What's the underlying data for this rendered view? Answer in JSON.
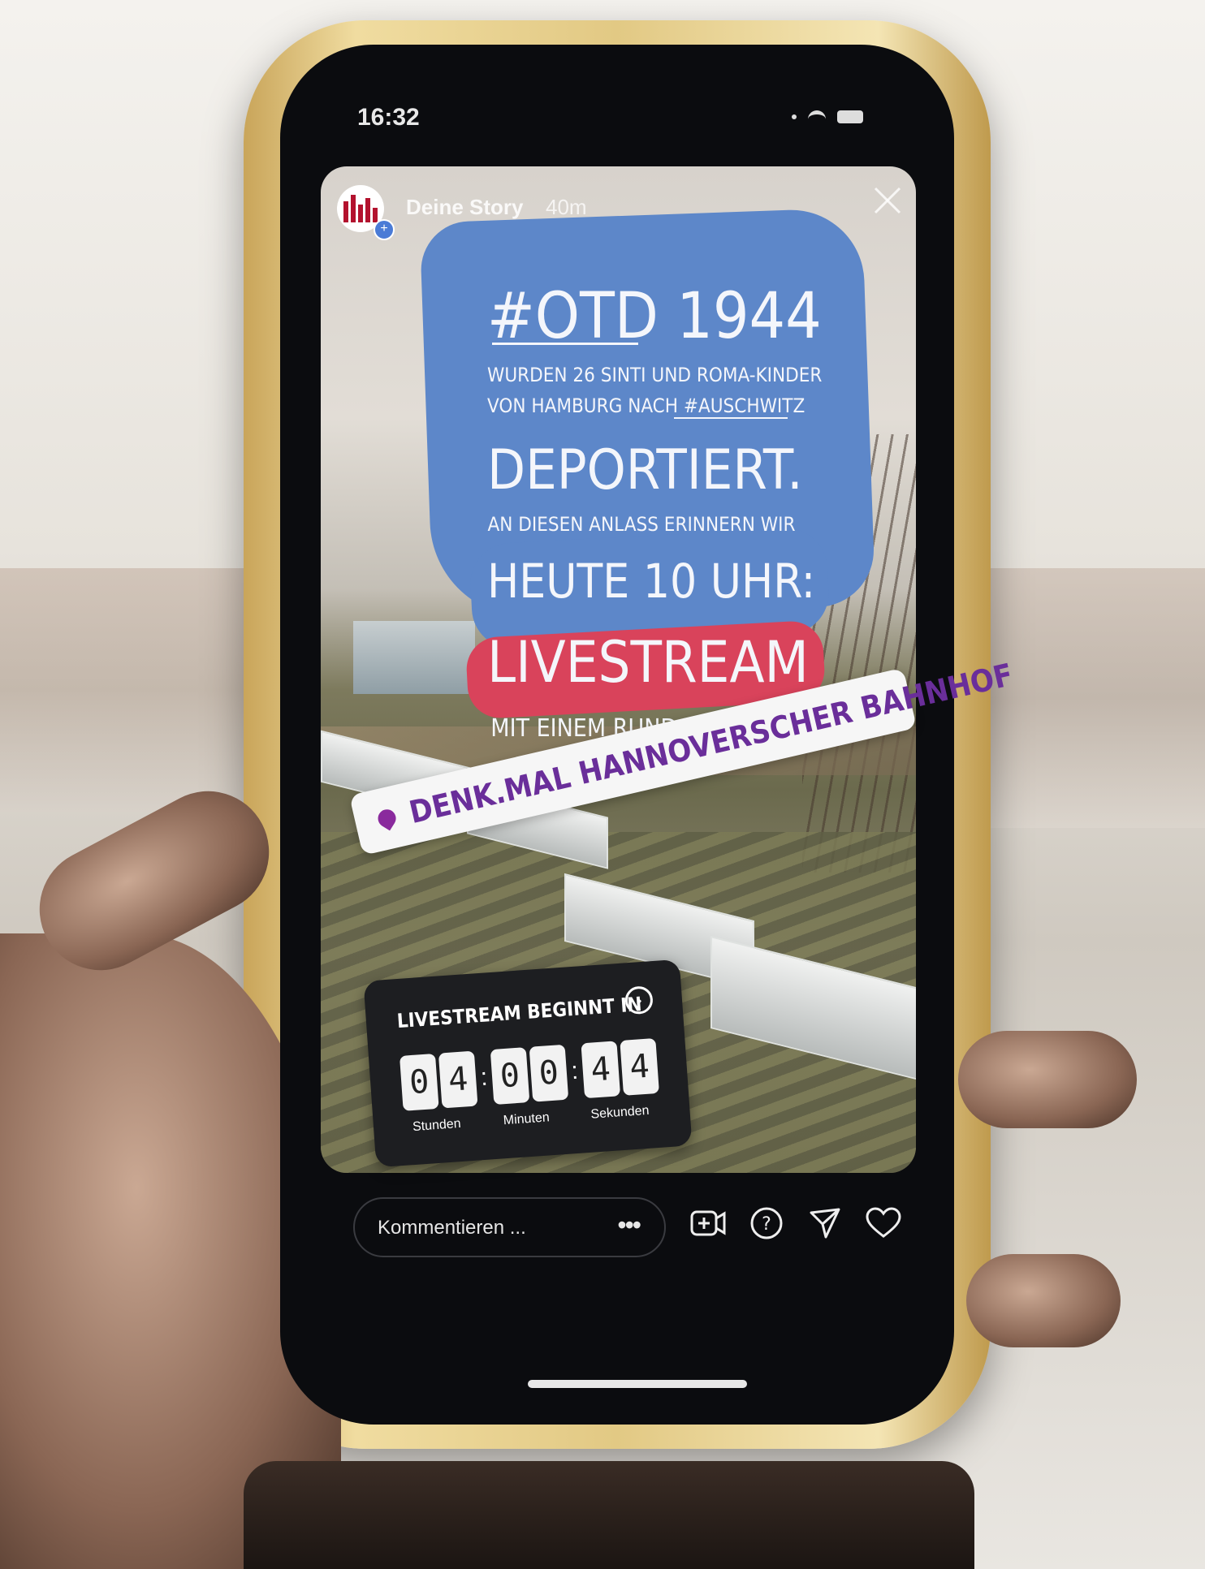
{
  "status_bar": {
    "time": "16:32"
  },
  "story": {
    "user": "Deine Story",
    "age": "40m",
    "text": {
      "hashtag": "#OTD 1944",
      "line1": "WURDEN 26 SINTI UND ROMA-KINDER",
      "line2": "VON HAMBURG NACH #AUSCHWITZ",
      "deportiert": "DEPORTIERT.",
      "line3": "AN DIESEN ANLASS ERINNERN WIR",
      "heute": "HEUTE 10 UHR:",
      "livestream": "LIVESTREAM",
      "line4": "MIT EINEM RUNDGANG VOM"
    },
    "location_sticker": "DENK.MAL HANNOVERSCHER BAHNHOF",
    "countdown": {
      "title": "LIVESTREAM BEGINNT IN",
      "digits": [
        "0",
        "4",
        "0",
        "0",
        "4",
        "4"
      ],
      "labels": {
        "hours": "Stunden",
        "minutes": "Minuten",
        "seconds": "Sekunden"
      }
    }
  },
  "reply_bar": {
    "placeholder": "Kommentieren ...",
    "more": "•••"
  },
  "colors": {
    "scribble_blue": "#5d87c9",
    "scribble_red": "#d9435b",
    "location_purple": "#6a2e9a"
  }
}
